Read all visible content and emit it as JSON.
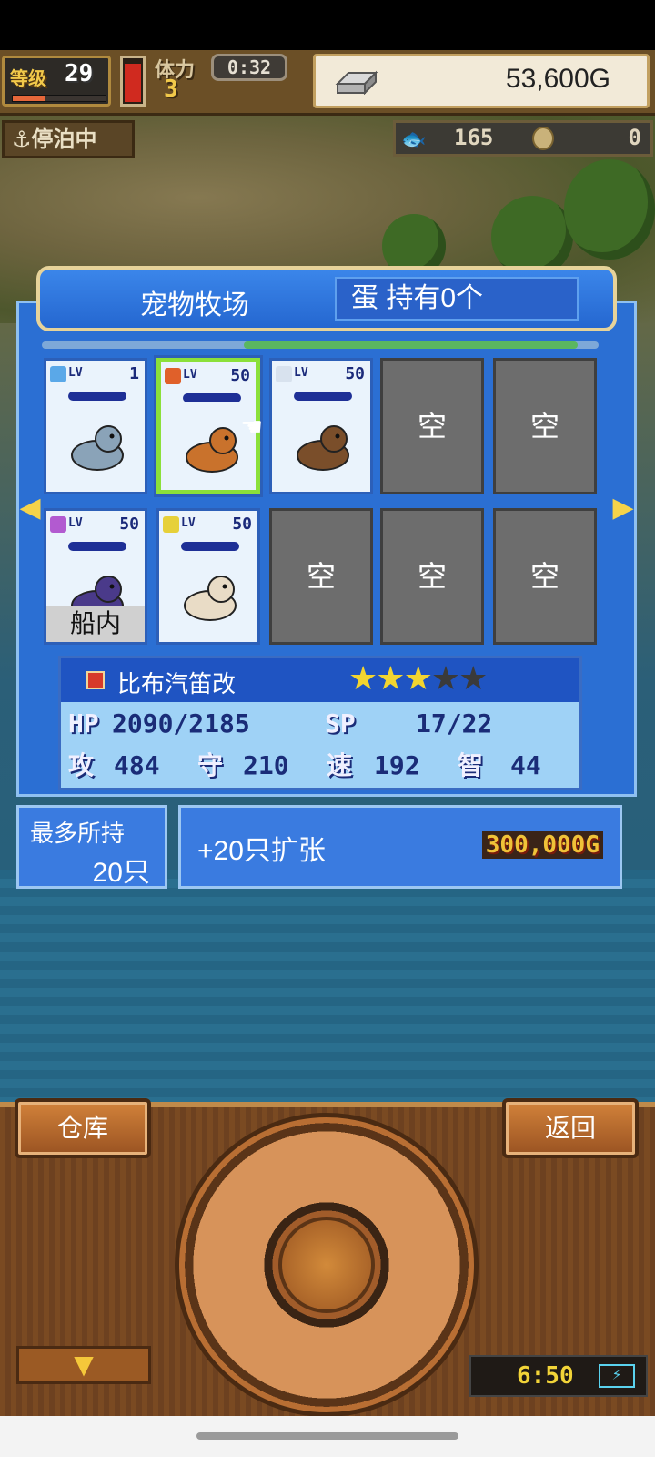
{
  "hud": {
    "level_label": "等级",
    "level": "29",
    "level_progress_percent": 35,
    "stamina_label": "体力",
    "stamina": "3",
    "stamina_gauge_percent": 85,
    "timer": "0:32",
    "gold": "53,600G",
    "status": "⚓停泊中",
    "fish_count": "165",
    "coin_count": "0"
  },
  "ranch": {
    "title": "宠物牧场",
    "egg_status": "蛋 持有0个",
    "scroll_percent": 60,
    "empty_label": "空",
    "slots_row1": [
      {
        "kind": "pet",
        "lv_label": "LV",
        "level": "1",
        "element_color": "#5aa8e8",
        "pet_color": "#8aa3b8"
      },
      {
        "kind": "pet",
        "lv_label": "LV",
        "level": "50",
        "element_color": "#e0602a",
        "pet_color": "#c9722c",
        "selected": true
      },
      {
        "kind": "pet",
        "lv_label": "LV",
        "level": "50",
        "element_color": "#d8e2ee",
        "pet_color": "#7a4e2a"
      },
      {
        "kind": "empty",
        "label": "空"
      },
      {
        "kind": "empty",
        "label": "空"
      }
    ],
    "slots_row2": [
      {
        "kind": "pet",
        "lv_label": "LV",
        "level": "50",
        "element_color": "#b25ad0",
        "pet_color": "#4a3a8a",
        "badge": "船内"
      },
      {
        "kind": "pet",
        "lv_label": "LV",
        "level": "50",
        "element_color": "#e6d03a",
        "pet_color": "#e9dcc6"
      },
      {
        "kind": "empty",
        "label": "空"
      },
      {
        "kind": "empty",
        "label": "空"
      },
      {
        "kind": "empty",
        "label": "空"
      }
    ]
  },
  "selected_pet": {
    "name": "比布汽笛改",
    "stars_filled": 3,
    "stars_total": 5,
    "hp_label": "HP",
    "hp": "2090/2185",
    "sp_label": "SP",
    "sp": "17/22",
    "atk_label": "攻",
    "atk": "484",
    "def_label": "守",
    "def": "210",
    "spd_label": "速",
    "spd": "192",
    "int_label": "智",
    "int": "44"
  },
  "capacity": {
    "label": "最多所持",
    "value": "20只",
    "expand_label": "+20只扩张",
    "expand_cost": "300,000G"
  },
  "controls": {
    "warehouse": "仓库",
    "back": "返回",
    "down_arrow": "▼",
    "clock": "6:50",
    "battery_icon": "⚡"
  },
  "colors": {
    "panel_blue": "#2b6fd3",
    "selected_border": "#8be03a",
    "star_on": "#f2d530",
    "gold_text": "#f0c238"
  }
}
